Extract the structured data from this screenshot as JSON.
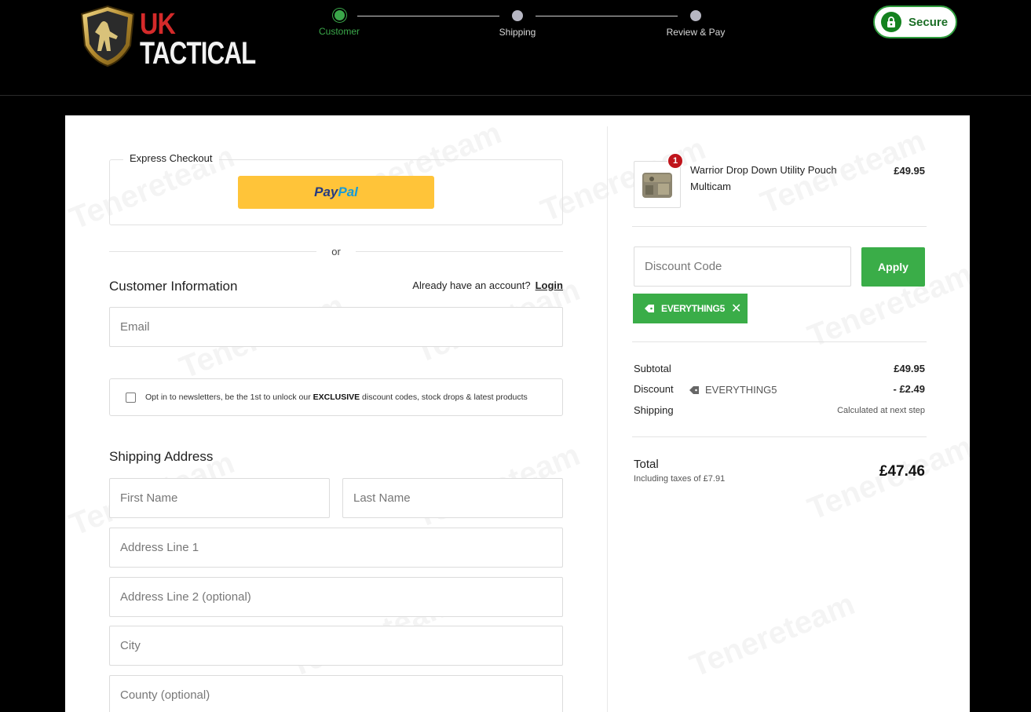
{
  "brand": {
    "line1": "UK",
    "line2": "TACTICAL"
  },
  "steps": [
    {
      "label": "Customer",
      "state": "active"
    },
    {
      "label": "Shipping",
      "state": "pending"
    },
    {
      "label": "Review & Pay",
      "state": "pending"
    }
  ],
  "secure_label": "Secure",
  "express": {
    "label": "Express Checkout",
    "paypal_part1": "Pay",
    "paypal_part2": "Pal"
  },
  "or_text": "or",
  "customer": {
    "title": "Customer Information",
    "account_prompt": "Already have an account?",
    "login_label": "Login",
    "email_placeholder": "Email",
    "optin_pre": "Opt in to newsletters, be the 1st to unlock our ",
    "optin_bold": "EXCLUSIVE",
    "optin_post": " discount codes, stock drops & latest products"
  },
  "shipping": {
    "title": "Shipping Address",
    "first_name_placeholder": "First Name",
    "last_name_placeholder": "Last Name",
    "address1_placeholder": "Address Line 1",
    "address2_placeholder": "Address Line 2 (optional)",
    "city_placeholder": "City",
    "county_placeholder": "County (optional)"
  },
  "cart": {
    "item": {
      "name": "Warrior Drop Down Utility Pouch Multicam",
      "qty": "1",
      "price": "£49.95"
    },
    "discount_placeholder": "Discount Code",
    "apply_label": "Apply",
    "applied_code": "EVERYTHING5",
    "subtotal_label": "Subtotal",
    "subtotal_value": "£49.95",
    "discount_label": "Discount",
    "discount_code": "EVERYTHING5",
    "discount_value": "- £2.49",
    "shipping_label": "Shipping",
    "shipping_value": "Calculated at next step",
    "total_label": "Total",
    "tax_note": "Including taxes of £7.91",
    "total_value": "£47.46"
  },
  "watermark_text": "Tenereteam",
  "colors": {
    "accent_green": "#3aad48",
    "badge_red": "#c0151c",
    "paypal_yellow": "#ffc439"
  }
}
